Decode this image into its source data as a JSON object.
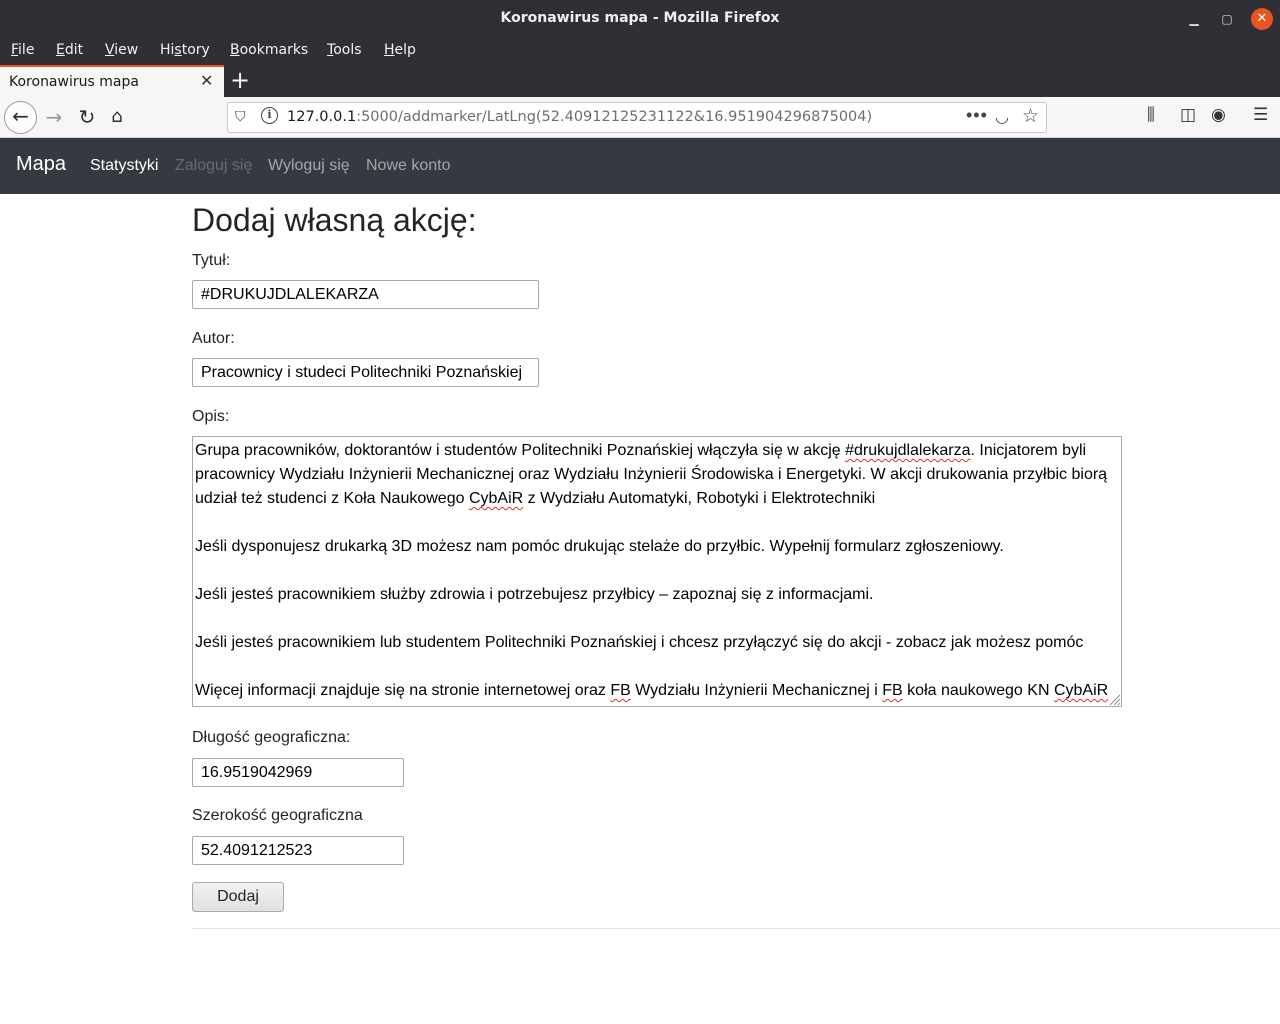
{
  "window": {
    "title": "Koronawirus mapa - Mozilla Firefox"
  },
  "menu": {
    "items": [
      {
        "prefix": "",
        "key": "F",
        "rest": "ile"
      },
      {
        "prefix": "",
        "key": "E",
        "rest": "dit"
      },
      {
        "prefix": "",
        "key": "V",
        "rest": "iew"
      },
      {
        "prefix": "Hi",
        "key": "s",
        "rest": "tory"
      },
      {
        "prefix": "",
        "key": "B",
        "rest": "ookmarks"
      },
      {
        "prefix": "",
        "key": "T",
        "rest": "ools"
      },
      {
        "prefix": "",
        "key": "H",
        "rest": "elp"
      }
    ]
  },
  "tab": {
    "title": "Koronawirus mapa",
    "close_glyph": "✕",
    "new_tab_glyph": "+"
  },
  "urlbar": {
    "host": "127.0.0.1",
    "rest": ":5000/addmarker/LatLng(52.40912125231122&16.951904296875004)",
    "more_glyph": "•••"
  },
  "site_nav": {
    "brand": "Mapa",
    "links": [
      "Statystyki",
      "Zaloguj się",
      "Wyloguj się",
      "Nowe konto"
    ]
  },
  "form": {
    "heading": "Dodaj własną akcję:",
    "title_label": "Tytuł:",
    "title_value": "#DRUKUJDLALEKARZA",
    "author_label": "Autor:",
    "author_value": "Pracownicy i studeci Politechniki Poznańskiej",
    "desc_label": "Opis:",
    "desc": {
      "p1a": "Grupa pracowników, doktorantów i studentów Politechniki Poznańskiej włączyła się w akcję ",
      "p1b": "#drukujdlalekarza",
      "p1c": ". Inicjatorem byli pracownicy Wydziału Inżynierii Mechanicznej oraz Wydziału Inżynierii Środowiska i Energetyki. W akcji drukowania przyłbic biorą udział też studenci z Koła Naukowego ",
      "p1d": "CybAiR",
      "p1e": " z Wydziału Automatyki, Robotyki i Elektrotechniki",
      "p2": "Jeśli dysponujesz drukarką 3D możesz nam pomóc drukując stelaże do przyłbic. Wypełnij formularz zgłoszeniowy.",
      "p3": "Jeśli jesteś pracownikiem służby zdrowia i potrzebujesz przyłbicy – zapoznaj się z informacjami.",
      "p4": "Jeśli jesteś pracownikiem lub studentem Politechniki Poznańskiej i chcesz przyłączyć się do akcji - zobacz jak możesz pomóc",
      "p5a": "Więcej informacji znajduje się na stronie internetowej oraz ",
      "p5b": "FB",
      "p5c": " Wydziału Inżynierii Mechanicznej i ",
      "p5d": "FB",
      "p5e": " koła naukowego KN ",
      "p5f": "CybAiR"
    },
    "lng_label": "Długość geograficzna:",
    "lng_value": "16.9519042969",
    "lat_label": "Szerokość geograficzna",
    "lat_value": "52.4091212523",
    "submit_label": "Dodaj"
  }
}
